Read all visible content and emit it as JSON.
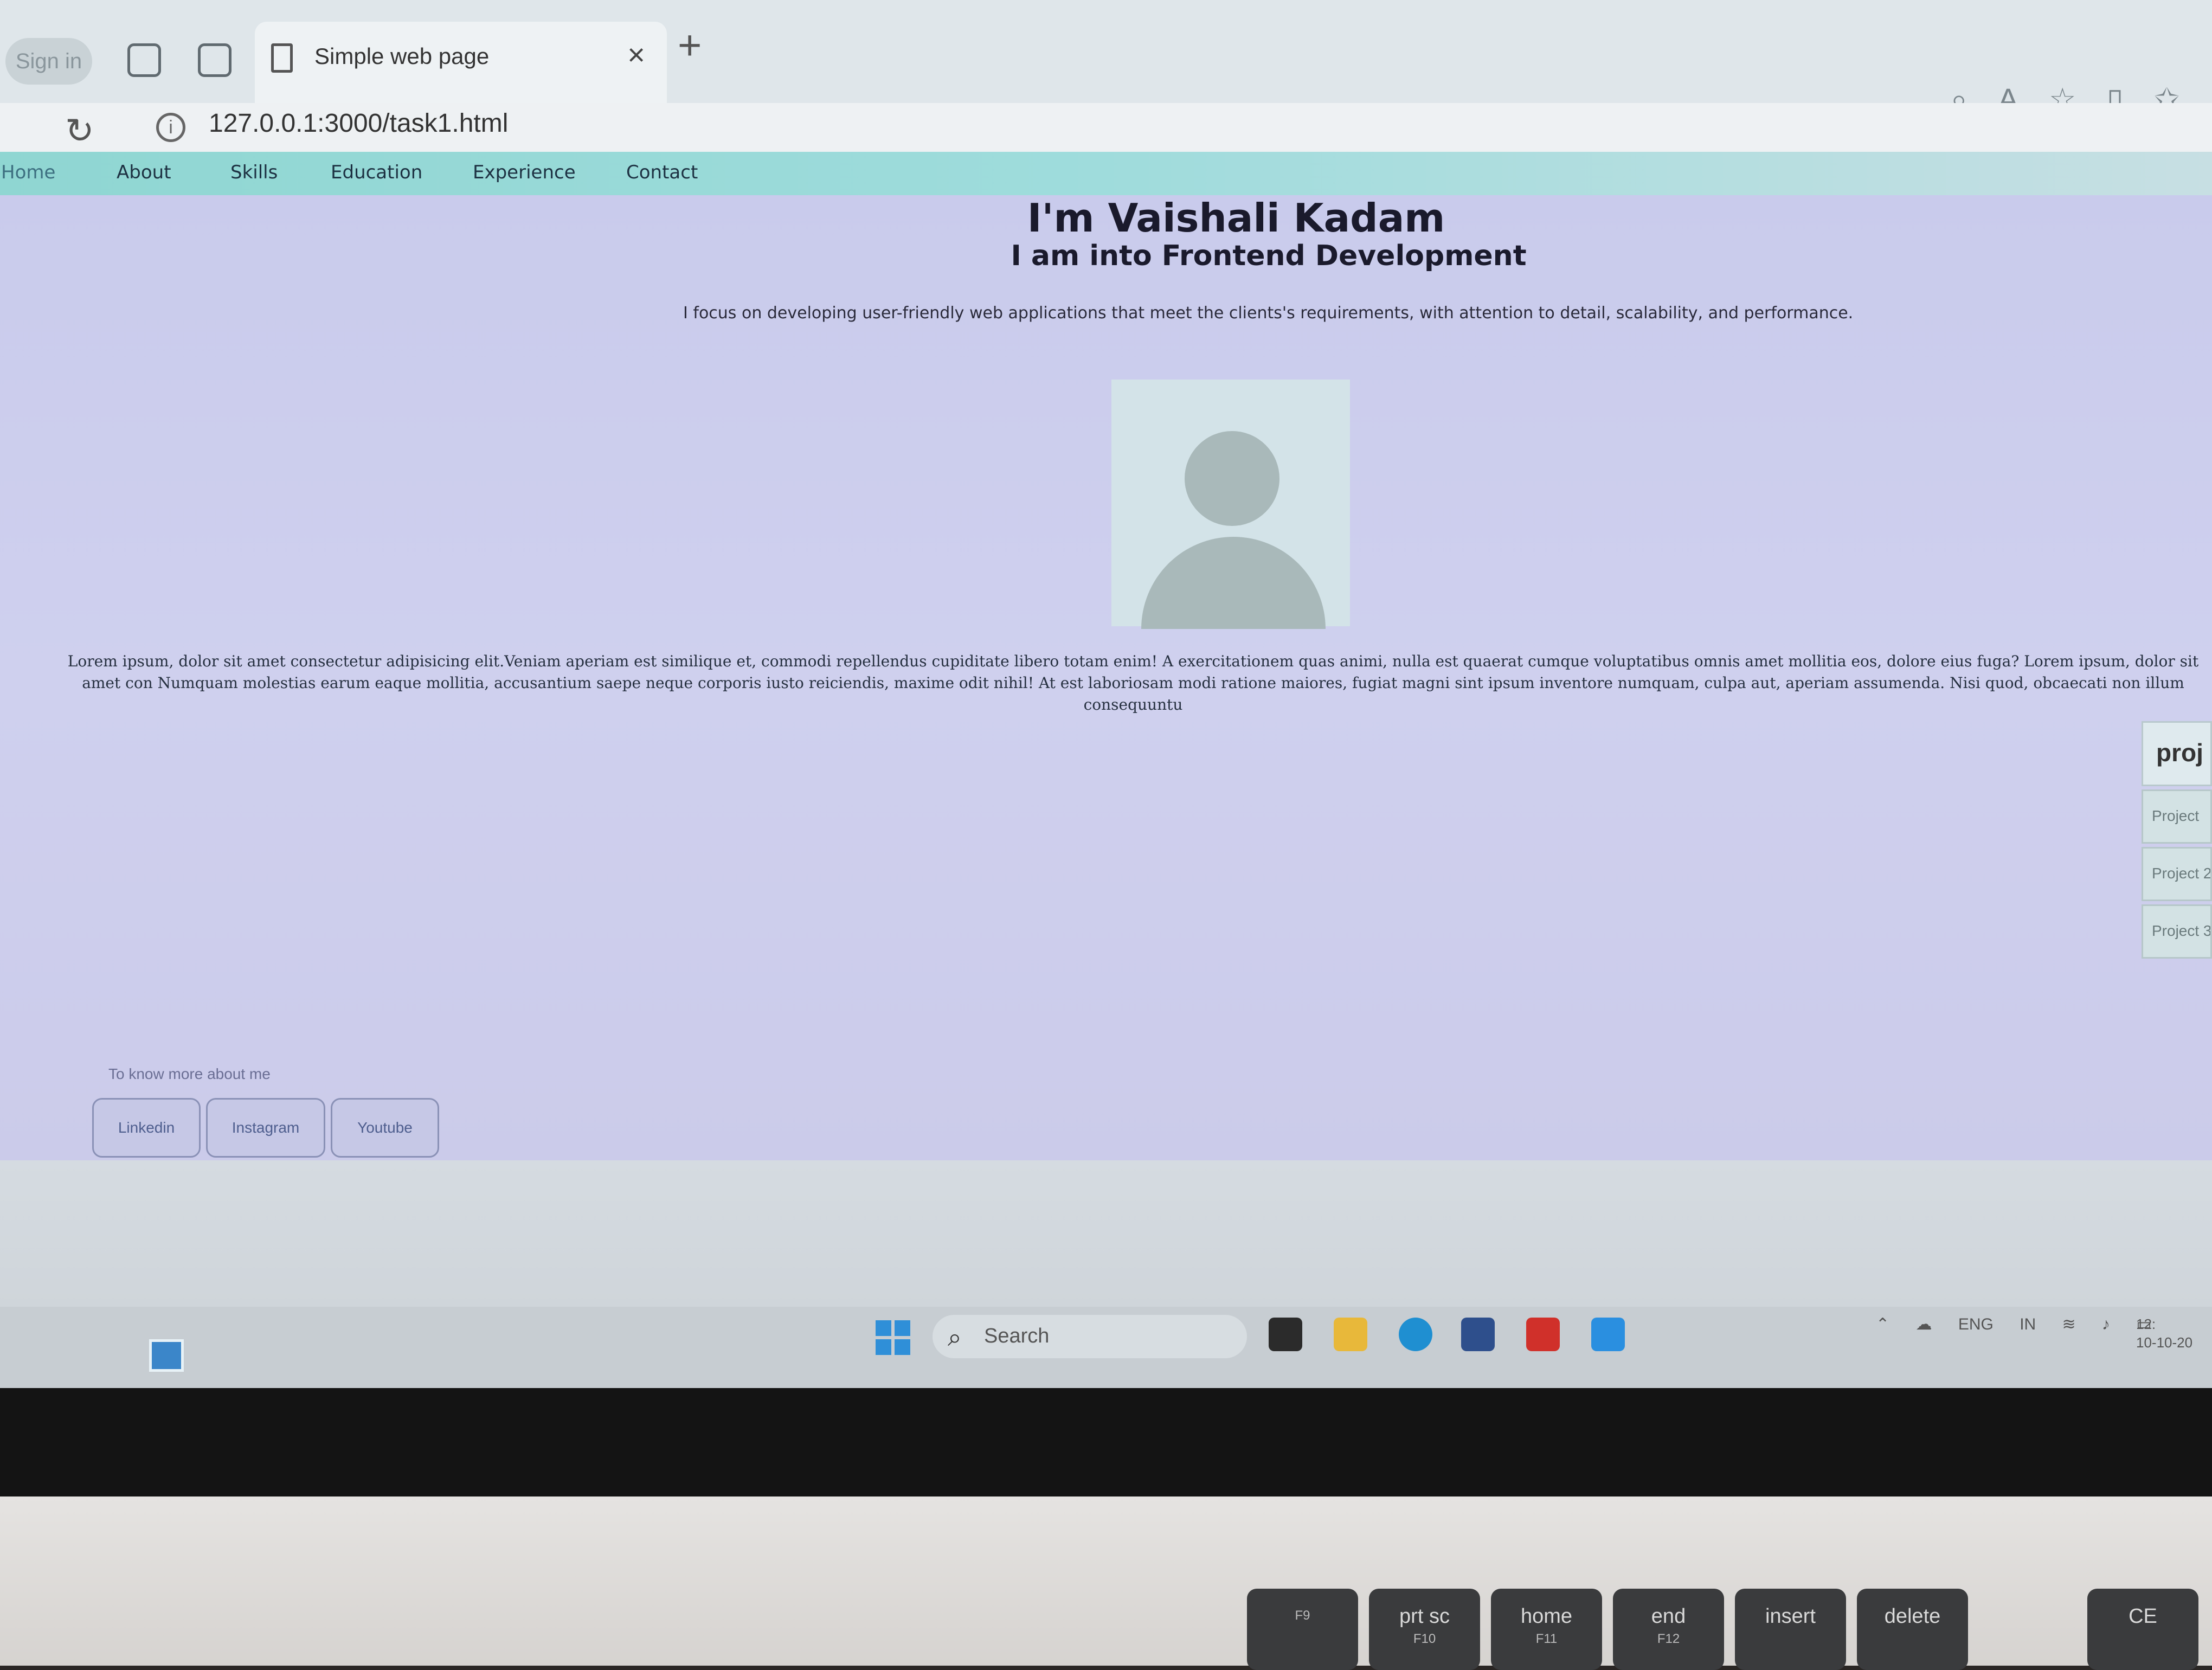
{
  "browser": {
    "sign_in_label": "Sign in",
    "tab_title": "Simple web page",
    "tab_close": "×",
    "new_tab": "+",
    "url": "127.0.0.1:3000/task1.html"
  },
  "nav": {
    "items": [
      "Home",
      "About",
      "Skills",
      "Education",
      "Experience",
      "Contact"
    ]
  },
  "hero": {
    "name": "I'm Vaishali Kadam",
    "role": "I am into Frontend Development",
    "description": "I focus on developing user-friendly web applications that meet the clients's requirements, with attention to detail, scalability, and performance."
  },
  "about": {
    "text": "Lorem ipsum, dolor sit amet consectetur adipisicing elit.Veniam aperiam est similique et, commodi repellendus cupiditate libero totam enim! A exercitationem quas animi, nulla est quaerat cumque voluptatibus omnis amet mollitia eos, dolore eius fuga? Lorem ipsum, dolor sit amet con Numquam molestias earum eaque mollitia, accusantium saepe neque corporis iusto reiciendis, maxime odit nihil! At est laboriosam modi ratione maiores, fugiat magni sint ipsum inventore numquam, culpa aut, aperiam assumenda. Nisi quod, obcaecati non illum consequuntu"
  },
  "projects": {
    "title": "proj",
    "items": [
      "Project",
      "Project 2",
      "Project 3"
    ]
  },
  "social": {
    "caption": "To know more about me",
    "buttons": [
      "Linkedin",
      "Instagram",
      "Youtube"
    ]
  },
  "taskbar": {
    "search_placeholder": "Search",
    "tray_lang": "ENG",
    "tray_region": "IN",
    "time": "12:",
    "date": "10-10-20"
  },
  "keyboard": {
    "keys": [
      {
        "label": "",
        "fn": "F9"
      },
      {
        "label": "prt sc",
        "fn": "F10"
      },
      {
        "label": "home",
        "fn": "F11"
      },
      {
        "label": "end",
        "fn": "F12"
      },
      {
        "label": "insert",
        "fn": ""
      },
      {
        "label": "delete",
        "fn": ""
      },
      {
        "label": "CE",
        "fn": ""
      }
    ]
  }
}
